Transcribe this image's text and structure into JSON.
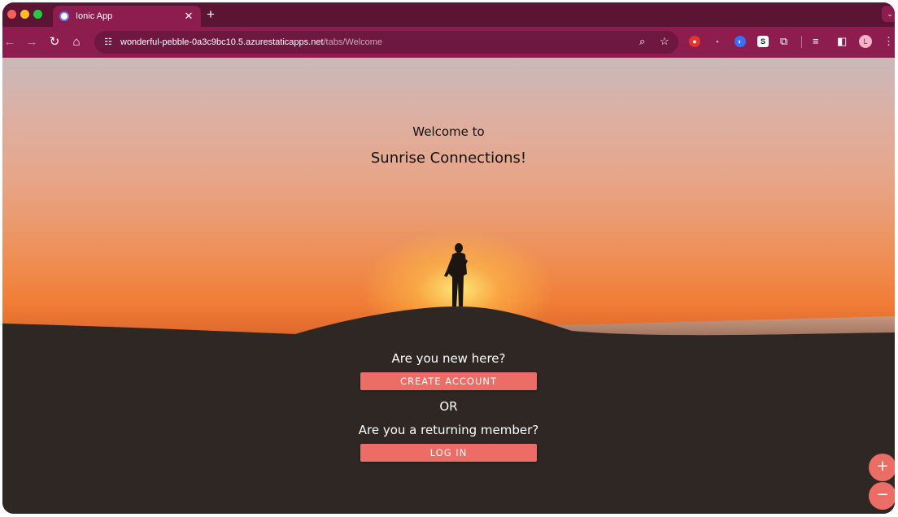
{
  "browser": {
    "tab": {
      "title": "Ionic App",
      "close_glyph": "✕"
    },
    "new_tab_glyph": "+",
    "profile_corner_glyph": "⌄",
    "toolbar": {
      "back_glyph": "←",
      "forward_glyph": "→",
      "reload_glyph": "↻",
      "home_glyph": "⌂",
      "site_info_glyph": "☷",
      "url_host": "wonderful-pebble-0a3c9bc10.5.azurestaticapps.net",
      "url_path": "/tabs/Welcome",
      "zoom_glyph": "⌕",
      "bookmark_glyph": "☆",
      "extensions": [
        {
          "name": "red-extension-icon",
          "color": "#e4342b",
          "label": "●"
        },
        {
          "name": "gray-extension-icon",
          "color": "#9a8a92",
          "label": "•"
        },
        {
          "name": "blue-extension-icon",
          "color": "#3a6ff7",
          "label": "◐"
        },
        {
          "name": "s-extension-icon",
          "color": "#ffffff",
          "label": "S"
        }
      ],
      "puzzle_glyph": "⧉",
      "media_glyph": "≡",
      "sidepanel_glyph": "◧",
      "avatar_letter": "L",
      "menu_glyph": "⋮"
    }
  },
  "welcome": {
    "line1": "Welcome to",
    "line2": "Sunrise Connections!"
  },
  "new_user": {
    "question": "Are you new here?",
    "button": "CREATE ACCOUNT"
  },
  "separator": "OR",
  "returning": {
    "question": "Are you a returning member?",
    "button": "LOG IN"
  },
  "zoom_controls": {
    "zoom_in": "+",
    "zoom_out": "−"
  },
  "colors": {
    "tabstrip": "#5c1434",
    "toolbar": "#8e1d4f",
    "accent_button": "#ec6d66"
  }
}
